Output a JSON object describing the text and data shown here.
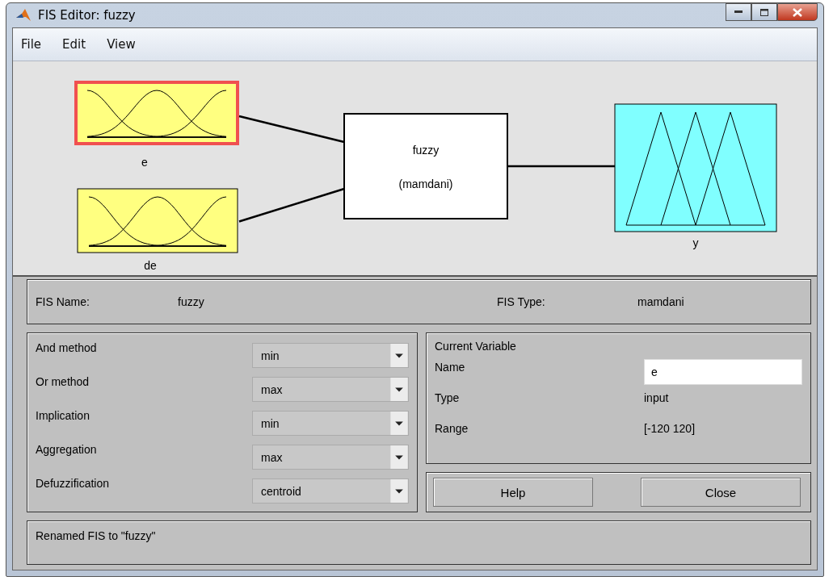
{
  "window": {
    "title": "FIS Editor: fuzzy"
  },
  "menu": [
    "File",
    "Edit",
    "View"
  ],
  "diagram": {
    "inputs": [
      {
        "name": "e",
        "kind": "gauss",
        "selected": true
      },
      {
        "name": "de",
        "kind": "gauss",
        "selected": false
      }
    ],
    "system": {
      "name": "fuzzy",
      "type": "(mamdani)"
    },
    "outputs": [
      {
        "name": "y",
        "kind": "tri",
        "selected": false
      }
    ]
  },
  "fis": {
    "name_label": "FIS Name:",
    "name": "fuzzy",
    "type_label": "FIS Type:",
    "type": "mamdani"
  },
  "methods": [
    {
      "label": "And method",
      "value": "min"
    },
    {
      "label": "Or method",
      "value": "max"
    },
    {
      "label": "Implication",
      "value": "min"
    },
    {
      "label": "Aggregation",
      "value": "max"
    },
    {
      "label": "Defuzzification",
      "value": "centroid"
    }
  ],
  "current_variable": {
    "title": "Current Variable",
    "name_label": "Name",
    "name": "e",
    "type_label": "Type",
    "type": "input",
    "range_label": "Range",
    "range": "[-120 120]"
  },
  "buttons": [
    "Help",
    "Close"
  ],
  "status": "Renamed FIS to \"fuzzy\""
}
